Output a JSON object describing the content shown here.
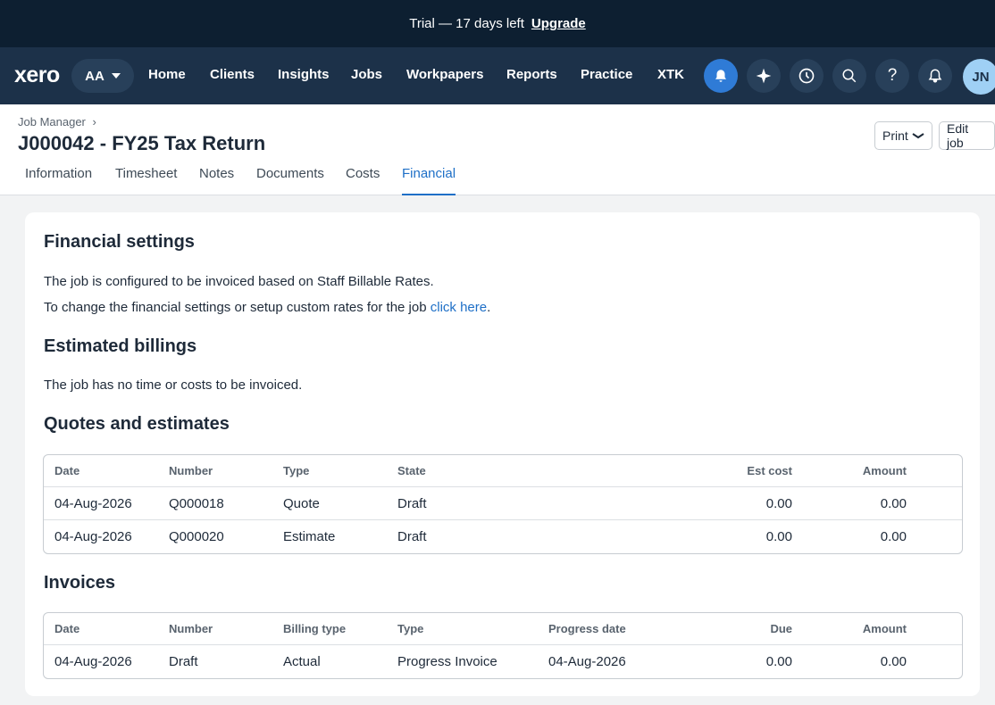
{
  "trial": {
    "text": "Trial — 17 days left",
    "upgrade": "Upgrade"
  },
  "nav": {
    "logo": "xero",
    "org": "AA",
    "items": [
      "Home",
      "Clients",
      "Insights",
      "Jobs",
      "Workpapers",
      "Reports",
      "Practice",
      "XTK"
    ],
    "icons": [
      "bell-icon",
      "sparkle-icon",
      "clock-icon",
      "search-icon",
      "help-icon",
      "notification-icon"
    ],
    "avatar": "JN"
  },
  "header": {
    "breadcrumb": "Job Manager",
    "breadcrumb_sep": "›",
    "title": "J000042 - FY25 Tax Return",
    "tabs": [
      "Information",
      "Timesheet",
      "Notes",
      "Documents",
      "Costs",
      "Financial"
    ],
    "active_tab": "Financial",
    "print_label": "Print",
    "edit_label": "Edit job"
  },
  "financial": {
    "heading": "Financial settings",
    "line1": "The job is configured to be invoiced based on Staff Billable Rates.",
    "line2": "To change the financial settings or setup custom rates for the job",
    "link": "click here",
    "line2_end": "."
  },
  "estimated": {
    "heading": "Estimated billings",
    "text": "The job has no time or costs to be invoiced."
  },
  "quotes": {
    "heading": "Quotes and estimates",
    "columns": [
      "Date",
      "Number",
      "Type",
      "State",
      "Est cost",
      "Amount"
    ],
    "rows": [
      [
        "04-Aug-2026",
        "Q000018",
        "Quote",
        "Draft",
        "0.00",
        "0.00"
      ],
      [
        "04-Aug-2026",
        "Q000020",
        "Estimate",
        "Draft",
        "0.00",
        "0.00"
      ]
    ]
  },
  "invoices": {
    "heading": "Invoices",
    "columns": [
      "Date",
      "Number",
      "Billing type",
      "Type",
      "Progress date",
      "Due",
      "Amount"
    ],
    "rows": [
      [
        "04-Aug-2026",
        "Draft",
        "Actual",
        "Progress Invoice",
        "04-Aug-2026",
        "0.00",
        "0.00"
      ]
    ]
  },
  "colors": {
    "nav_bg": "#1c3149",
    "trial_bg": "#0d1f31",
    "accent": "#1e6fc7",
    "active_icon": "#2f7bd6"
  }
}
